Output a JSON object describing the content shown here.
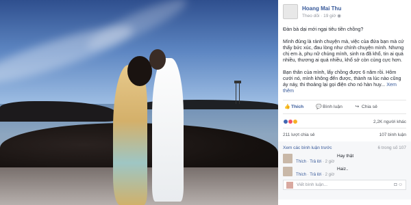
{
  "post": {
    "author": "Hoang Mai Thu",
    "follow_label": "Theo dõi",
    "time": "19 giờ",
    "paragraphs": [
      "Đàn bà dại mới ngại tiêu tiền chồng?",
      "Mình đúng là rảnh chuyện mà, việc của đứa bạn mà cứ thấy bức xúc, đau lòng như chính chuyện mình. Nhưng chị em à, phụ nữ chúng mình, sinh ra đã khổ, tin ai quá nhiều, thương ai quá nhiều, khổ sở còn cùng cực hơn.",
      "Bạn thân của mình, lấy chồng được 6 năm rồi. Hôm cưới nó, mình không đến được, thành ra lúc nào cũng áy náy, thi thoảng lại gọi điện cho nó hàn huy..."
    ],
    "see_more": "Xem thêm"
  },
  "actions": {
    "like": "Thích",
    "comment": "Bình luận",
    "share": "Chia sẻ"
  },
  "reactions": {
    "count": "2,2K người khác",
    "colors": [
      "#4267b2",
      "#f25268",
      "#f7b125"
    ]
  },
  "stats": {
    "shares": "211 lượt chia sẻ",
    "comments": "107 bình luận"
  },
  "comments": {
    "view_previous": "Xem các bình luận trước",
    "count": "6 trong số 107",
    "items": [
      {
        "text": "Hay thật",
        "like": "Thích",
        "reply": "Trả lời",
        "time": "2 giờ"
      },
      {
        "text": "Haiz..",
        "like": "Thích",
        "reply": "Trả lời",
        "time": "2 giờ"
      }
    ],
    "write_placeholder": "Viết bình luận..."
  }
}
